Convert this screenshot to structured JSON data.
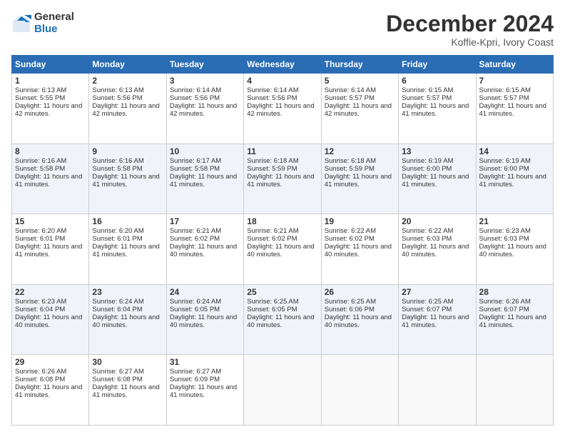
{
  "logo": {
    "general": "General",
    "blue": "Blue"
  },
  "header": {
    "title": "December 2024",
    "subtitle": "Koffie-Kpri, Ivory Coast"
  },
  "days": [
    "Sunday",
    "Monday",
    "Tuesday",
    "Wednesday",
    "Thursday",
    "Friday",
    "Saturday"
  ],
  "weeks": [
    [
      {
        "day": "1",
        "sunrise": "6:13 AM",
        "sunset": "5:55 PM",
        "daylight": "11 hours and 42 minutes."
      },
      {
        "day": "2",
        "sunrise": "6:13 AM",
        "sunset": "5:56 PM",
        "daylight": "11 hours and 42 minutes."
      },
      {
        "day": "3",
        "sunrise": "6:14 AM",
        "sunset": "5:56 PM",
        "daylight": "11 hours and 42 minutes."
      },
      {
        "day": "4",
        "sunrise": "6:14 AM",
        "sunset": "5:56 PM",
        "daylight": "11 hours and 42 minutes."
      },
      {
        "day": "5",
        "sunrise": "6:14 AM",
        "sunset": "5:57 PM",
        "daylight": "11 hours and 42 minutes."
      },
      {
        "day": "6",
        "sunrise": "6:15 AM",
        "sunset": "5:57 PM",
        "daylight": "11 hours and 41 minutes."
      },
      {
        "day": "7",
        "sunrise": "6:15 AM",
        "sunset": "5:57 PM",
        "daylight": "11 hours and 41 minutes."
      }
    ],
    [
      {
        "day": "8",
        "sunrise": "6:16 AM",
        "sunset": "5:58 PM",
        "daylight": "11 hours and 41 minutes."
      },
      {
        "day": "9",
        "sunrise": "6:16 AM",
        "sunset": "5:58 PM",
        "daylight": "11 hours and 41 minutes."
      },
      {
        "day": "10",
        "sunrise": "6:17 AM",
        "sunset": "5:58 PM",
        "daylight": "11 hours and 41 minutes."
      },
      {
        "day": "11",
        "sunrise": "6:18 AM",
        "sunset": "5:59 PM",
        "daylight": "11 hours and 41 minutes."
      },
      {
        "day": "12",
        "sunrise": "6:18 AM",
        "sunset": "5:59 PM",
        "daylight": "11 hours and 41 minutes."
      },
      {
        "day": "13",
        "sunrise": "6:19 AM",
        "sunset": "6:00 PM",
        "daylight": "11 hours and 41 minutes."
      },
      {
        "day": "14",
        "sunrise": "6:19 AM",
        "sunset": "6:00 PM",
        "daylight": "11 hours and 41 minutes."
      }
    ],
    [
      {
        "day": "15",
        "sunrise": "6:20 AM",
        "sunset": "6:01 PM",
        "daylight": "11 hours and 41 minutes."
      },
      {
        "day": "16",
        "sunrise": "6:20 AM",
        "sunset": "6:01 PM",
        "daylight": "11 hours and 41 minutes."
      },
      {
        "day": "17",
        "sunrise": "6:21 AM",
        "sunset": "6:02 PM",
        "daylight": "11 hours and 40 minutes."
      },
      {
        "day": "18",
        "sunrise": "6:21 AM",
        "sunset": "6:02 PM",
        "daylight": "11 hours and 40 minutes."
      },
      {
        "day": "19",
        "sunrise": "6:22 AM",
        "sunset": "6:02 PM",
        "daylight": "11 hours and 40 minutes."
      },
      {
        "day": "20",
        "sunrise": "6:22 AM",
        "sunset": "6:03 PM",
        "daylight": "11 hours and 40 minutes."
      },
      {
        "day": "21",
        "sunrise": "6:23 AM",
        "sunset": "6:03 PM",
        "daylight": "11 hours and 40 minutes."
      }
    ],
    [
      {
        "day": "22",
        "sunrise": "6:23 AM",
        "sunset": "6:04 PM",
        "daylight": "11 hours and 40 minutes."
      },
      {
        "day": "23",
        "sunrise": "6:24 AM",
        "sunset": "6:04 PM",
        "daylight": "11 hours and 40 minutes."
      },
      {
        "day": "24",
        "sunrise": "6:24 AM",
        "sunset": "6:05 PM",
        "daylight": "11 hours and 40 minutes."
      },
      {
        "day": "25",
        "sunrise": "6:25 AM",
        "sunset": "6:05 PM",
        "daylight": "11 hours and 40 minutes."
      },
      {
        "day": "26",
        "sunrise": "6:25 AM",
        "sunset": "6:06 PM",
        "daylight": "11 hours and 40 minutes."
      },
      {
        "day": "27",
        "sunrise": "6:25 AM",
        "sunset": "6:07 PM",
        "daylight": "11 hours and 41 minutes."
      },
      {
        "day": "28",
        "sunrise": "6:26 AM",
        "sunset": "6:07 PM",
        "daylight": "11 hours and 41 minutes."
      }
    ],
    [
      {
        "day": "29",
        "sunrise": "6:26 AM",
        "sunset": "6:08 PM",
        "daylight": "11 hours and 41 minutes."
      },
      {
        "day": "30",
        "sunrise": "6:27 AM",
        "sunset": "6:08 PM",
        "daylight": "11 hours and 41 minutes."
      },
      {
        "day": "31",
        "sunrise": "6:27 AM",
        "sunset": "6:09 PM",
        "daylight": "11 hours and 41 minutes."
      },
      null,
      null,
      null,
      null
    ]
  ]
}
